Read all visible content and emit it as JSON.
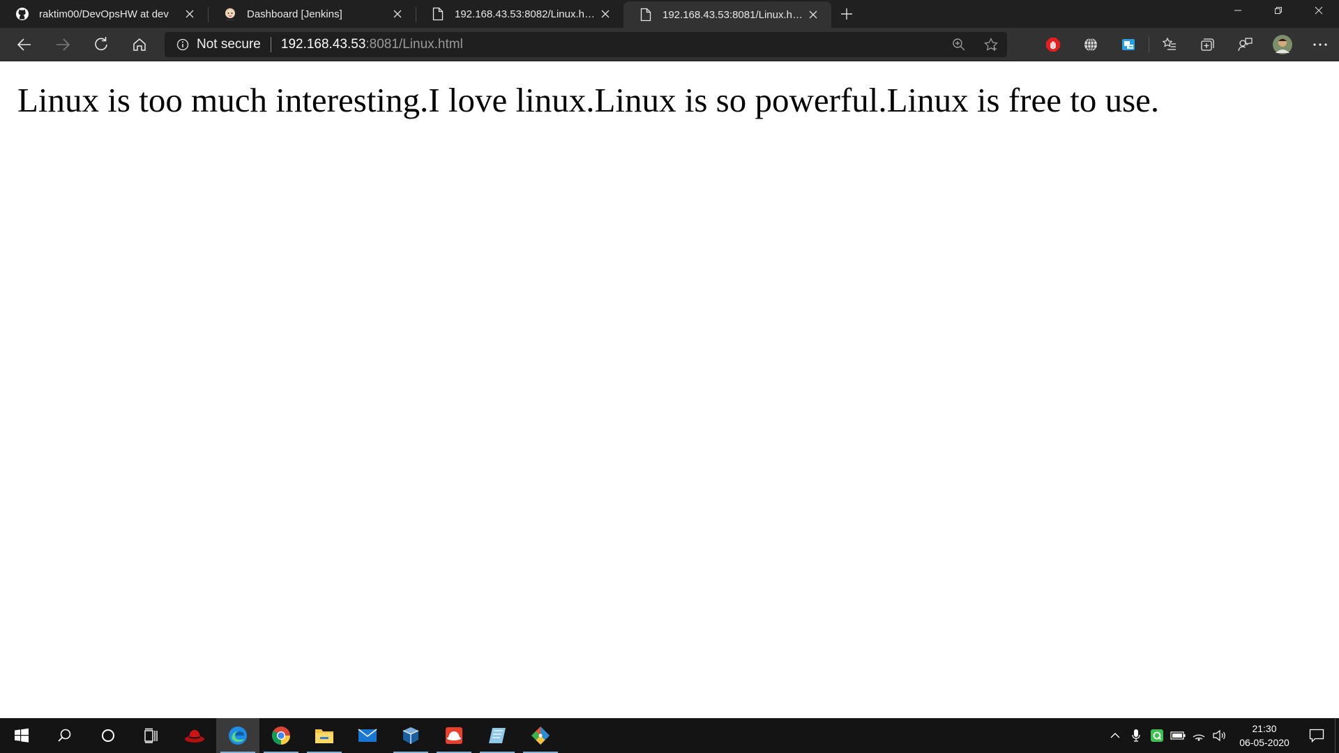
{
  "browser": {
    "tabs": [
      {
        "title": "raktim00/DevOpsHW at dev",
        "icon": "github-icon"
      },
      {
        "title": "Dashboard [Jenkins]",
        "icon": "jenkins-icon"
      },
      {
        "title": "192.168.43.53:8082/Linux.html",
        "icon": "page-icon"
      },
      {
        "title": "192.168.43.53:8081/Linux.html",
        "icon": "page-icon",
        "active": true
      }
    ],
    "address": {
      "security_label": "Not secure",
      "host": "192.168.43.53",
      "path": ":8081/Linux.html"
    }
  },
  "page": {
    "text": "Linux is too much interesting.I love linux.Linux is so powerful.Linux is free to use."
  },
  "taskbar": {
    "clock_time": "21:30",
    "clock_date": "06-05-2020"
  },
  "colors": {
    "chrome_dark": "#202020",
    "toolbar": "#323232",
    "taskbar": "#141414",
    "edge_blue": "#1f8ce6"
  }
}
